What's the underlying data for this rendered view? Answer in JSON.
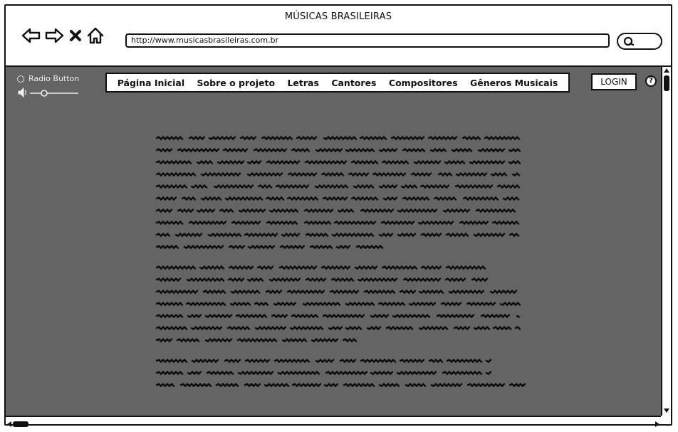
{
  "window": {
    "title": "MÚSICAS BRASILEIRAS"
  },
  "browser": {
    "url": "http://www.musicasbrasileiras.com.br",
    "icons": [
      "back-arrow-icon",
      "forward-arrow-icon",
      "close-x-icon",
      "home-icon",
      "search-icon"
    ]
  },
  "sidebar": {
    "radio_label": "Radio Button",
    "volume_icon": "speaker-icon"
  },
  "nav": {
    "items": [
      "Página Inicial",
      "Sobre o projeto",
      "Letras",
      "Cantores",
      "Compositores",
      "Gêneros Musicais"
    ]
  },
  "header": {
    "login_label": "LOGIN",
    "help_label": "?"
  },
  "colors": {
    "content_bg": "#646464",
    "text_squiggle": "#0d0d0d",
    "frame": "#111111"
  }
}
